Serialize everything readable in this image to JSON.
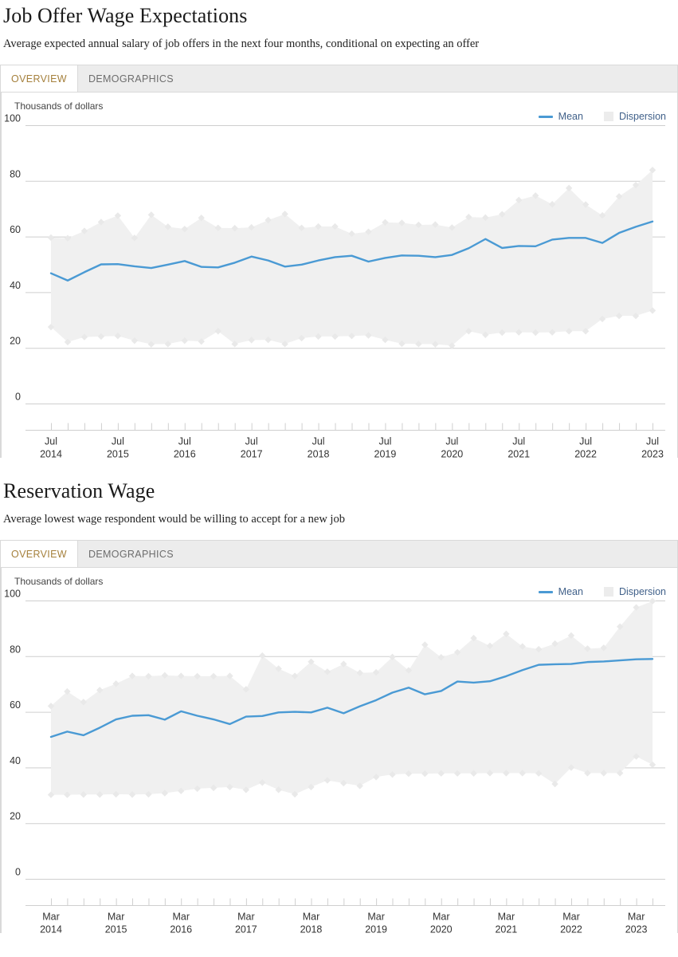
{
  "sections": [
    {
      "title": "Job Offer Wage Expectations",
      "subtitle": "Average expected annual salary of job offers in the next four months, conditional on expecting an offer",
      "tabs": [
        {
          "label": "OVERVIEW",
          "active": true
        },
        {
          "label": "DEMOGRAPHICS",
          "active": false
        }
      ],
      "legend": [
        {
          "label": "Mean",
          "type": "line",
          "color": "#4a9ad4"
        },
        {
          "label": "Dispersion",
          "type": "box",
          "color": "#ececec"
        }
      ],
      "chart_data": {
        "type": "line",
        "title": "Job Offer Wage Expectations",
        "subtitle": "Average expected annual salary of job offers in the next four months, conditional on expecting an offer",
        "ylabel": "Thousands of dollars",
        "xlabel": "",
        "ylim": [
          0,
          100
        ],
        "yticks": [
          0,
          20,
          40,
          60,
          80,
          100
        ],
        "grid": true,
        "legend_position": "top-right",
        "x": [
          "Jul 2014",
          "Oct 2014",
          "Jan 2015",
          "Apr 2015",
          "Jul 2015",
          "Oct 2015",
          "Jan 2016",
          "Apr 2016",
          "Jul 2016",
          "Oct 2016",
          "Jan 2017",
          "Apr 2017",
          "Jul 2017",
          "Oct 2017",
          "Jan 2018",
          "Apr 2018",
          "Jul 2018",
          "Oct 2018",
          "Jan 2019",
          "Apr 2019",
          "Jul 2019",
          "Oct 2019",
          "Jan 2020",
          "Apr 2020",
          "Jul 2020",
          "Oct 2020",
          "Jan 2021",
          "Apr 2021",
          "Jul 2021",
          "Oct 2021",
          "Jan 2022",
          "Apr 2022",
          "Jul 2022",
          "Oct 2022",
          "Jan 2023",
          "Apr 2023",
          "Jul 2023"
        ],
        "xtick_labels": [
          {
            "index": 0,
            "line1": "Jul",
            "line2": "2014"
          },
          {
            "index": 4,
            "line1": "Jul",
            "line2": "2015"
          },
          {
            "index": 8,
            "line1": "Jul",
            "line2": "2016"
          },
          {
            "index": 12,
            "line1": "Jul",
            "line2": "2017"
          },
          {
            "index": 16,
            "line1": "Jul",
            "line2": "2018"
          },
          {
            "index": 20,
            "line1": "Jul",
            "line2": "2019"
          },
          {
            "index": 24,
            "line1": "Jul",
            "line2": "2020"
          },
          {
            "index": 28,
            "line1": "Jul",
            "line2": "2021"
          },
          {
            "index": 32,
            "line1": "Jul",
            "line2": "2022"
          },
          {
            "index": 36,
            "line1": "Jul",
            "line2": "2023"
          }
        ],
        "series": [
          {
            "name": "Mean",
            "color": "#4a9ad4",
            "values": [
              46.8,
              44.2,
              47.2,
              50.0,
              50.1,
              49.3,
              48.7,
              49.9,
              51.2,
              49.1,
              48.9,
              50.6,
              52.8,
              51.4,
              49.2,
              49.9,
              51.4,
              52.6,
              53.1,
              51.0,
              52.3,
              53.2,
              53.1,
              52.6,
              53.4,
              55.8,
              59.1,
              55.9,
              56.6,
              56.5,
              58.9,
              59.5,
              59.5,
              57.7,
              61.3,
              63.5,
              65.4
            ]
          }
        ],
        "dispersion": {
          "name": "Dispersion",
          "color": "#f0f0f0",
          "upper": [
            59.6,
            59.4,
            62.0,
            65.2,
            67.5,
            59.5,
            67.8,
            63.5,
            62.7,
            66.7,
            63.1,
            63.0,
            63.3,
            65.9,
            68.1,
            63.1,
            63.6,
            63.6,
            61.0,
            61.7,
            65.1,
            64.9,
            64.2,
            64.3,
            63.2,
            67.0,
            66.8,
            68.0,
            73.1,
            74.7,
            71.6,
            77.4,
            71.5,
            67.6,
            74.4,
            78.5,
            83.9
          ],
          "lower": [
            27.5,
            22.1,
            23.9,
            24.1,
            24.3,
            22.6,
            21.3,
            21.4,
            22.6,
            22.3,
            26.0,
            21.4,
            22.8,
            22.9,
            21.4,
            23.5,
            24.1,
            24.1,
            24.3,
            24.5,
            22.9,
            21.5,
            21.4,
            21.3,
            20.8,
            26.0,
            24.7,
            25.5,
            25.6,
            25.5,
            25.6,
            26.0,
            26.0,
            30.4,
            31.5,
            31.5,
            33.4
          ]
        }
      }
    },
    {
      "title": "Reservation Wage",
      "subtitle": "Average lowest wage respondent would be willing to accept for a new job",
      "tabs": [
        {
          "label": "OVERVIEW",
          "active": true
        },
        {
          "label": "DEMOGRAPHICS",
          "active": false
        }
      ],
      "legend": [
        {
          "label": "Mean",
          "type": "line",
          "color": "#4a9ad4"
        },
        {
          "label": "Dispersion",
          "type": "box",
          "color": "#ececec"
        }
      ],
      "chart_data": {
        "type": "line",
        "title": "Reservation Wage",
        "subtitle": "Average lowest wage respondent would be willing to accept for a new job",
        "ylabel": "Thousands of dollars",
        "xlabel": "",
        "ylim": [
          0,
          100
        ],
        "yticks": [
          0,
          20,
          40,
          60,
          80,
          100
        ],
        "grid": true,
        "legend_position": "top-right",
        "x": [
          "Mar 2014",
          "Jun 2014",
          "Sep 2014",
          "Dec 2014",
          "Mar 2015",
          "Jun 2015",
          "Sep 2015",
          "Dec 2015",
          "Mar 2016",
          "Jun 2016",
          "Sep 2016",
          "Dec 2016",
          "Mar 2017",
          "Jun 2017",
          "Sep 2017",
          "Dec 2017",
          "Mar 2018",
          "Jun 2018",
          "Sep 2018",
          "Dec 2018",
          "Mar 2019",
          "Jun 2019",
          "Sep 2019",
          "Dec 2019",
          "Mar 2020",
          "Jun 2020",
          "Sep 2020",
          "Dec 2020",
          "Mar 2021",
          "Jun 2021",
          "Sep 2021",
          "Dec 2021",
          "Mar 2022",
          "Jun 2022",
          "Sep 2022",
          "Dec 2022",
          "Mar 2023",
          "Jun 2023"
        ],
        "xtick_labels": [
          {
            "index": 0,
            "line1": "Mar",
            "line2": "2014"
          },
          {
            "index": 4,
            "line1": "Mar",
            "line2": "2015"
          },
          {
            "index": 8,
            "line1": "Mar",
            "line2": "2016"
          },
          {
            "index": 12,
            "line1": "Mar",
            "line2": "2017"
          },
          {
            "index": 16,
            "line1": "Mar",
            "line2": "2018"
          },
          {
            "index": 20,
            "line1": "Mar",
            "line2": "2019"
          },
          {
            "index": 24,
            "line1": "Mar",
            "line2": "2020"
          },
          {
            "index": 28,
            "line1": "Mar",
            "line2": "2021"
          },
          {
            "index": 32,
            "line1": "Mar",
            "line2": "2022"
          },
          {
            "index": 36,
            "line1": "Mar",
            "line2": "2023"
          }
        ],
        "series": [
          {
            "name": "Mean",
            "color": "#4a9ad4",
            "values": [
              51.0,
              52.9,
              51.6,
              54.3,
              57.3,
              58.6,
              58.8,
              57.2,
              60.2,
              58.6,
              57.3,
              55.6,
              58.3,
              58.5,
              59.8,
              60.0,
              59.8,
              61.5,
              59.5,
              62.0,
              64.2,
              66.9,
              68.7,
              66.3,
              67.5,
              70.9,
              70.5,
              71.0,
              72.8,
              75.0,
              76.9,
              77.1,
              77.2,
              77.9,
              78.1,
              78.5,
              78.9,
              79.0
            ]
          }
        ],
        "dispersion": {
          "name": "Dispersion",
          "color": "#f0f0f0",
          "upper": [
            62.1,
            67.3,
            63.5,
            67.8,
            70.1,
            72.9,
            72.8,
            73.1,
            72.9,
            72.8,
            72.8,
            72.9,
            68.1,
            80.2,
            75.5,
            72.9,
            78.0,
            74.4,
            77.2,
            74.0,
            74.2,
            79.7,
            74.9,
            84.1,
            79.6,
            81.4,
            86.5,
            83.7,
            88.0,
            83.5,
            82.5,
            84.5,
            87.4,
            82.7,
            83.0,
            90.6,
            97.5,
            99.8
          ],
          "lower": [
            30.2,
            30.2,
            30.3,
            30.3,
            30.4,
            30.3,
            30.4,
            30.8,
            31.6,
            32.4,
            32.7,
            33.0,
            32.0,
            34.6,
            32.0,
            30.4,
            33.0,
            35.4,
            34.4,
            33.4,
            36.6,
            37.5,
            37.8,
            37.8,
            37.9,
            37.9,
            37.9,
            38.0,
            38.0,
            38.0,
            37.9,
            34.1,
            40.0,
            38.0,
            38.0,
            38.0,
            44.0,
            41.0
          ]
        }
      }
    }
  ]
}
